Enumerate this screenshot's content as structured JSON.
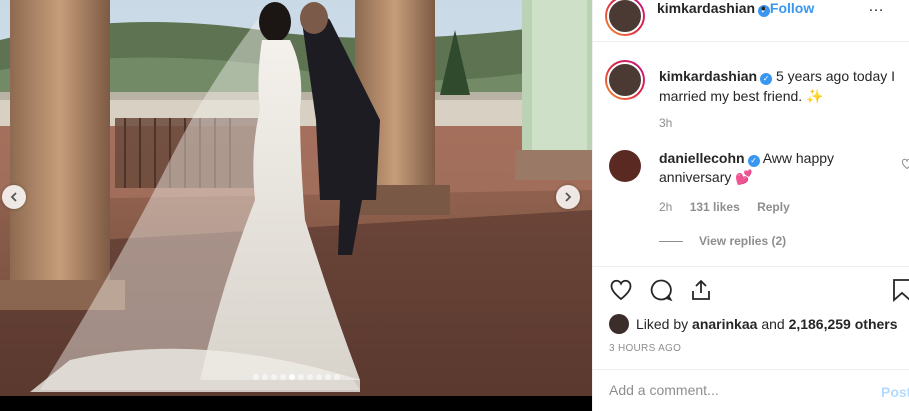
{
  "post": {
    "author": "kimkardashian",
    "follow_separator": "•",
    "follow_label": "Follow",
    "more_label": "…",
    "carousel_total": 10,
    "carousel_active": 5
  },
  "caption": {
    "username": "kimkardashian",
    "text": "5 years ago today I married my best friend. ✨",
    "time": "3h"
  },
  "comment": {
    "username": "daniellecohn",
    "text": "Aww happy anniversary 💕",
    "time": "2h",
    "likes": "131 likes",
    "reply_label": "Reply",
    "view_replies": "View replies (2)"
  },
  "likes": {
    "prefix": "Liked by",
    "first_user": "anarinkaa",
    "and": "and",
    "count": "2,186,259 others"
  },
  "time_ago": "3 HOURS AGO",
  "add_comment": {
    "placeholder": "Add a comment...",
    "post_label": "Post"
  },
  "colors": {
    "link": "#3897f0",
    "muted": "#8e8e8e",
    "post_disabled": "#b3dbff"
  },
  "icons": [
    "chevron-left-icon",
    "chevron-right-icon",
    "verified-icon",
    "heart-icon",
    "comment-icon",
    "share-icon",
    "bookmark-icon"
  ]
}
